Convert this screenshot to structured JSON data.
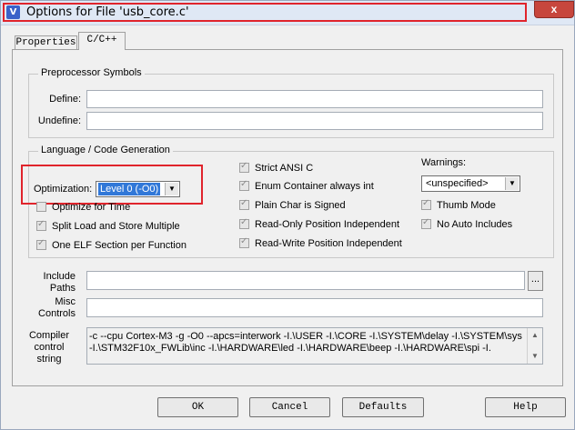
{
  "window": {
    "title": "Options for File 'usb_core.c'",
    "close_glyph": "x"
  },
  "tabs": [
    {
      "label": "Properties"
    },
    {
      "label": "C/C++"
    }
  ],
  "preprocessor": {
    "legend": "Preprocessor Symbols",
    "define_label": "Define:",
    "define_value": "",
    "undefine_label": "Undefine:",
    "undefine_value": ""
  },
  "language": {
    "legend": "Language / Code Generation",
    "optimization_label": "Optimization:",
    "optimization_value": "Level 0 (-O0)",
    "optimize_time": "Optimize for Time",
    "split_load": "Split Load and Store Multiple",
    "one_elf": "One ELF Section per Function",
    "strict_ansi": "Strict ANSI C",
    "enum_container": "Enum Container always int",
    "plain_char": "Plain Char is Signed",
    "ro_pi": "Read-Only Position Independent",
    "rw_pi": "Read-Write Position Independent",
    "warnings_label": "Warnings:",
    "warnings_value": "<unspecified>",
    "thumb_mode": "Thumb Mode",
    "no_auto_includes": "No Auto Includes"
  },
  "include": {
    "label_1": "Include",
    "label_2": "Paths",
    "value": "",
    "browse": "..."
  },
  "misc": {
    "label_1": "Misc",
    "label_2": "Controls",
    "value": ""
  },
  "compiler": {
    "label_1": "Compiler",
    "label_2": "control",
    "label_3": "string",
    "text": "-c --cpu Cortex-M3 -g -O0 --apcs=interwork -I.\\USER -I.\\CORE -I.\\SYSTEM\\delay -I.\\SYSTEM\\sys -I.\\STM32F10x_FWLib\\inc -I.\\HARDWARE\\led -I.\\HARDWARE\\beep -I.\\HARDWARE\\spi -I."
  },
  "buttons": {
    "ok": "OK",
    "cancel": "Cancel",
    "defaults": "Defaults",
    "help": "Help"
  },
  "glyphs": {
    "check": "✓",
    "arrow_down": "▼",
    "arrow_up": "▲"
  },
  "colors": {
    "highlight": "#e0242c",
    "titlebar": "#dfe8f5",
    "dialog_bg": "#f0f0f0"
  }
}
